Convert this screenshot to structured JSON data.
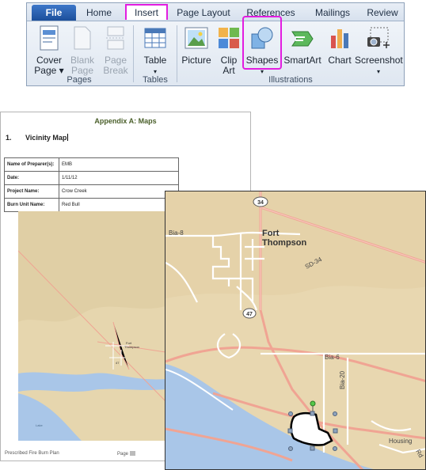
{
  "ribbon": {
    "tabs": [
      "File",
      "Home",
      "Insert",
      "Page Layout",
      "References",
      "Mailings",
      "Review"
    ],
    "active_tab": "Insert",
    "groups": {
      "pages": {
        "label": "Pages",
        "buttons": [
          {
            "l1": "Cover",
            "l2": "Page ▾"
          },
          {
            "l1": "Blank",
            "l2": "Page"
          },
          {
            "l1": "Page",
            "l2": "Break"
          }
        ]
      },
      "tables": {
        "label": "Tables",
        "buttons": [
          {
            "l1": "Table",
            "l2": "▾"
          }
        ]
      },
      "illustrations": {
        "label": "Illustrations",
        "buttons": [
          {
            "l1": "Picture",
            "l2": ""
          },
          {
            "l1": "Clip",
            "l2": "Art"
          },
          {
            "l1": "Shapes",
            "l2": "▾"
          },
          {
            "l1": "SmartArt",
            "l2": ""
          },
          {
            "l1": "Chart",
            "l2": ""
          },
          {
            "l1": "Screenshot",
            "l2": "▾"
          }
        ]
      }
    }
  },
  "document": {
    "appendix_title": "Appendix A: Maps",
    "heading": "1.       Vicinity Map",
    "info_rows": [
      {
        "k": "Name of Preparer(s):",
        "v": "EMB"
      },
      {
        "k": "Date:",
        "v": "1/11/12"
      },
      {
        "k": "Project Name:",
        "v": "Crow Creek"
      },
      {
        "k": "Burn Unit Name:",
        "v": "Red Bull"
      }
    ],
    "footer_left": "Prescribed Fire Burn Plan",
    "footer_page": "Page",
    "small_map_labels": {
      "fort": "Fort",
      "thompson": "Thompson",
      "lake": "Lake",
      "route": "47"
    }
  },
  "map": {
    "labels": {
      "fort": "Fort",
      "thompson": "Thompson",
      "bia8": "Bia-8",
      "sd34": "SD-34",
      "bia6": "Bia-6",
      "bia20": "Bia-20",
      "housing": "Housing",
      "rd": "Rd",
      "shield_34": "34",
      "shield_47": "47"
    },
    "colors": {
      "land": "#e8d7b0",
      "water": "#a9c6e8",
      "major_road": "#f0a493",
      "minor_road": "#ffffff"
    }
  }
}
